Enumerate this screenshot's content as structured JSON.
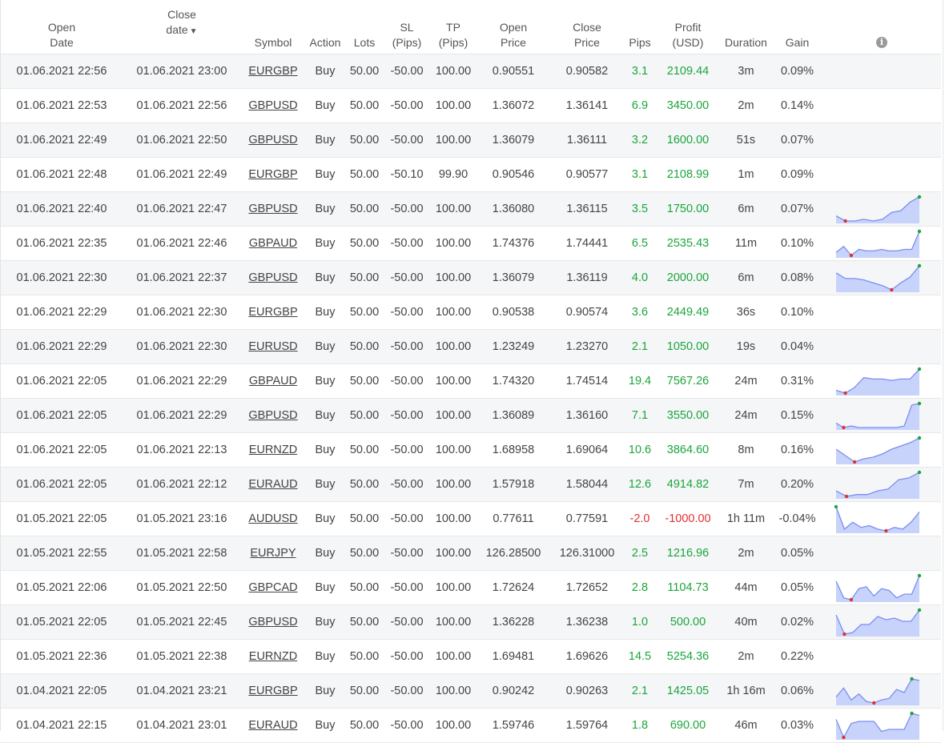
{
  "headers": {
    "open_date": [
      "Open",
      "Date"
    ],
    "close_date": [
      "Close",
      "date"
    ],
    "close_caret": "▼",
    "symbol": "Symbol",
    "action": "Action",
    "lots": "Lots",
    "sl": [
      "SL",
      "(Pips)"
    ],
    "tp": [
      "TP",
      "(Pips)"
    ],
    "open_price": [
      "Open",
      "Price"
    ],
    "close_price": [
      "Close",
      "Price"
    ],
    "pips": "Pips",
    "profit": [
      "Profit",
      "(USD)"
    ],
    "duration": "Duration",
    "gain": "Gain",
    "info_icon": "i"
  },
  "colors": {
    "positive": "#1aa63a",
    "negative": "#e03131",
    "spark_fill": "#c7d3fb",
    "spark_line": "#7b8ef0",
    "spark_max": "#1aa63a",
    "spark_min": "#e03131"
  },
  "rows": [
    {
      "open": "01.06.2021 22:56",
      "close": "01.06.2021 23:00",
      "symbol": "EURGBP",
      "action": "Buy",
      "lots": "50.00",
      "sl": "-50.00",
      "tp": "100.00",
      "open_price": "0.90551",
      "close_price": "0.90582",
      "pips": "3.1",
      "profit": "2109.44",
      "duration": "3m",
      "gain": "0.09%",
      "neg": false,
      "spark": null
    },
    {
      "open": "01.06.2021 22:53",
      "close": "01.06.2021 22:56",
      "symbol": "GBPUSD",
      "action": "Buy",
      "lots": "50.00",
      "sl": "-50.00",
      "tp": "100.00",
      "open_price": "1.36072",
      "close_price": "1.36141",
      "pips": "6.9",
      "profit": "3450.00",
      "duration": "2m",
      "gain": "0.14%",
      "neg": false,
      "spark": null
    },
    {
      "open": "01.06.2021 22:49",
      "close": "01.06.2021 22:50",
      "symbol": "GBPUSD",
      "action": "Buy",
      "lots": "50.00",
      "sl": "-50.00",
      "tp": "100.00",
      "open_price": "1.36079",
      "close_price": "1.36111",
      "pips": "3.2",
      "profit": "1600.00",
      "duration": "51s",
      "gain": "0.07%",
      "neg": false,
      "spark": null
    },
    {
      "open": "01.06.2021 22:48",
      "close": "01.06.2021 22:49",
      "symbol": "EURGBP",
      "action": "Buy",
      "lots": "50.00",
      "sl": "-50.10",
      "tp": "99.90",
      "open_price": "0.90546",
      "close_price": "0.90577",
      "pips": "3.1",
      "profit": "2108.99",
      "duration": "1m",
      "gain": "0.09%",
      "neg": false,
      "spark": null
    },
    {
      "open": "01.06.2021 22:40",
      "close": "01.06.2021 22:47",
      "symbol": "GBPUSD",
      "action": "Buy",
      "lots": "50.00",
      "sl": "-50.00",
      "tp": "100.00",
      "open_price": "1.36080",
      "close_price": "1.36115",
      "pips": "3.5",
      "profit": "1750.00",
      "duration": "6m",
      "gain": "0.07%",
      "neg": false,
      "spark": [
        3,
        0,
        0,
        1,
        0,
        1,
        5,
        6,
        11,
        14
      ]
    },
    {
      "open": "01.06.2021 22:35",
      "close": "01.06.2021 22:46",
      "symbol": "GBPAUD",
      "action": "Buy",
      "lots": "50.00",
      "sl": "-50.00",
      "tp": "100.00",
      "open_price": "1.74376",
      "close_price": "1.74441",
      "pips": "6.5",
      "profit": "2535.43",
      "duration": "11m",
      "gain": "0.10%",
      "neg": false,
      "spark": [
        2,
        6,
        0,
        4,
        3,
        3,
        4,
        3,
        3,
        4,
        4,
        16
      ]
    },
    {
      "open": "01.06.2021 22:30",
      "close": "01.06.2021 22:37",
      "symbol": "GBPUSD",
      "action": "Buy",
      "lots": "50.00",
      "sl": "-50.00",
      "tp": "100.00",
      "open_price": "1.36079",
      "close_price": "1.36119",
      "pips": "4.0",
      "profit": "2000.00",
      "duration": "6m",
      "gain": "0.08%",
      "neg": false,
      "spark": [
        12,
        8,
        8,
        7,
        5,
        3,
        0,
        5,
        9,
        17
      ]
    },
    {
      "open": "01.06.2021 22:29",
      "close": "01.06.2021 22:30",
      "symbol": "EURGBP",
      "action": "Buy",
      "lots": "50.00",
      "sl": "-50.00",
      "tp": "100.00",
      "open_price": "0.90538",
      "close_price": "0.90574",
      "pips": "3.6",
      "profit": "2449.49",
      "duration": "36s",
      "gain": "0.10%",
      "neg": false,
      "spark": null
    },
    {
      "open": "01.06.2021 22:29",
      "close": "01.06.2021 22:30",
      "symbol": "EURUSD",
      "action": "Buy",
      "lots": "50.00",
      "sl": "-50.00",
      "tp": "100.00",
      "open_price": "1.23249",
      "close_price": "1.23270",
      "pips": "2.1",
      "profit": "1050.00",
      "duration": "19s",
      "gain": "0.04%",
      "neg": false,
      "spark": null
    },
    {
      "open": "01.06.2021 22:05",
      "close": "01.06.2021 22:29",
      "symbol": "GBPAUD",
      "action": "Buy",
      "lots": "50.00",
      "sl": "-50.00",
      "tp": "100.00",
      "open_price": "1.74320",
      "close_price": "1.74514",
      "pips": "19.4",
      "profit": "7567.26",
      "duration": "24m",
      "gain": "0.31%",
      "neg": false,
      "spark": [
        2,
        0,
        4,
        11,
        10,
        10,
        9,
        10,
        10,
        17
      ]
    },
    {
      "open": "01.06.2021 22:05",
      "close": "01.06.2021 22:29",
      "symbol": "GBPUSD",
      "action": "Buy",
      "lots": "50.00",
      "sl": "-50.00",
      "tp": "100.00",
      "open_price": "1.36089",
      "close_price": "1.36160",
      "pips": "7.1",
      "profit": "3550.00",
      "duration": "24m",
      "gain": "0.15%",
      "neg": false,
      "spark": [
        4,
        1,
        2,
        1,
        1,
        1,
        1,
        1,
        1,
        2,
        16,
        17
      ]
    },
    {
      "open": "01.06.2021 22:05",
      "close": "01.06.2021 22:13",
      "symbol": "EURNZD",
      "action": "Buy",
      "lots": "50.00",
      "sl": "-50.00",
      "tp": "100.00",
      "open_price": "1.68958",
      "close_price": "1.69064",
      "pips": "10.6",
      "profit": "3864.60",
      "duration": "8m",
      "gain": "0.16%",
      "neg": false,
      "spark": [
        8,
        4,
        0,
        2,
        3,
        5,
        8,
        10,
        12,
        15
      ]
    },
    {
      "open": "01.06.2021 22:05",
      "close": "01.06.2021 22:12",
      "symbol": "EURAUD",
      "action": "Buy",
      "lots": "50.00",
      "sl": "-50.00",
      "tp": "100.00",
      "open_price": "1.57918",
      "close_price": "1.58044",
      "pips": "12.6",
      "profit": "4914.82",
      "duration": "7m",
      "gain": "0.20%",
      "neg": false,
      "spark": [
        4,
        1,
        2,
        2,
        4,
        5,
        10,
        11,
        14
      ]
    },
    {
      "open": "01.05.2021 22:05",
      "close": "01.05.2021 23:16",
      "symbol": "AUDUSD",
      "action": "Buy",
      "lots": "50.00",
      "sl": "-50.00",
      "tp": "100.00",
      "open_price": "0.77611",
      "close_price": "0.77591",
      "pips": "-2.0",
      "profit": "-1000.00",
      "duration": "1h 11m",
      "gain": "-0.04%",
      "neg": true,
      "spark": [
        15,
        2,
        6,
        3,
        4,
        2,
        1,
        3,
        2,
        6,
        12
      ]
    },
    {
      "open": "01.05.2021 22:55",
      "close": "01.05.2021 22:58",
      "symbol": "EURJPY",
      "action": "Buy",
      "lots": "50.00",
      "sl": "-50.00",
      "tp": "100.00",
      "open_price": "126.28500",
      "close_price": "126.31000",
      "pips": "2.5",
      "profit": "1216.96",
      "duration": "2m",
      "gain": "0.05%",
      "neg": false,
      "spark": null
    },
    {
      "open": "01.05.2021 22:06",
      "close": "01.05.2021 22:50",
      "symbol": "GBPCAD",
      "action": "Buy",
      "lots": "50.00",
      "sl": "-50.00",
      "tp": "100.00",
      "open_price": "1.72624",
      "close_price": "1.72652",
      "pips": "2.8",
      "profit": "1104.73",
      "duration": "44m",
      "gain": "0.05%",
      "neg": false,
      "spark": [
        12,
        3,
        2,
        8,
        9,
        4,
        8,
        7,
        3,
        5,
        5,
        15
      ]
    },
    {
      "open": "01.05.2021 22:05",
      "close": "01.05.2021 22:45",
      "symbol": "GBPUSD",
      "action": "Buy",
      "lots": "50.00",
      "sl": "-50.00",
      "tp": "100.00",
      "open_price": "1.36228",
      "close_price": "1.36238",
      "pips": "1.0",
      "profit": "500.00",
      "duration": "40m",
      "gain": "0.02%",
      "neg": false,
      "spark": [
        12,
        0,
        1,
        6,
        6,
        11,
        9,
        10,
        8,
        8,
        15
      ]
    },
    {
      "open": "01.05.2021 22:36",
      "close": "01.05.2021 22:38",
      "symbol": "EURNZD",
      "action": "Buy",
      "lots": "50.00",
      "sl": "-50.00",
      "tp": "100.00",
      "open_price": "1.69481",
      "close_price": "1.69626",
      "pips": "14.5",
      "profit": "5254.36",
      "duration": "2m",
      "gain": "0.22%",
      "neg": false,
      "spark": null
    },
    {
      "open": "01.04.2021 22:05",
      "close": "01.04.2021 23:21",
      "symbol": "EURGBP",
      "action": "Buy",
      "lots": "50.00",
      "sl": "-50.00",
      "tp": "100.00",
      "open_price": "0.90242",
      "close_price": "0.90263",
      "pips": "2.1",
      "profit": "1425.05",
      "duration": "1h 16m",
      "gain": "0.06%",
      "neg": false,
      "spark": [
        5,
        11,
        3,
        7,
        2,
        1,
        3,
        4,
        10,
        8,
        17,
        16
      ]
    },
    {
      "open": "01.04.2021 22:15",
      "close": "01.04.2021 23:01",
      "symbol": "EURAUD",
      "action": "Buy",
      "lots": "50.00",
      "sl": "-50.00",
      "tp": "100.00",
      "open_price": "1.59746",
      "close_price": "1.59764",
      "pips": "1.8",
      "profit": "690.00",
      "duration": "46m",
      "gain": "0.03%",
      "neg": false,
      "spark": [
        10,
        1,
        8,
        9,
        9,
        9,
        4,
        5,
        5,
        5,
        13,
        12
      ]
    }
  ]
}
